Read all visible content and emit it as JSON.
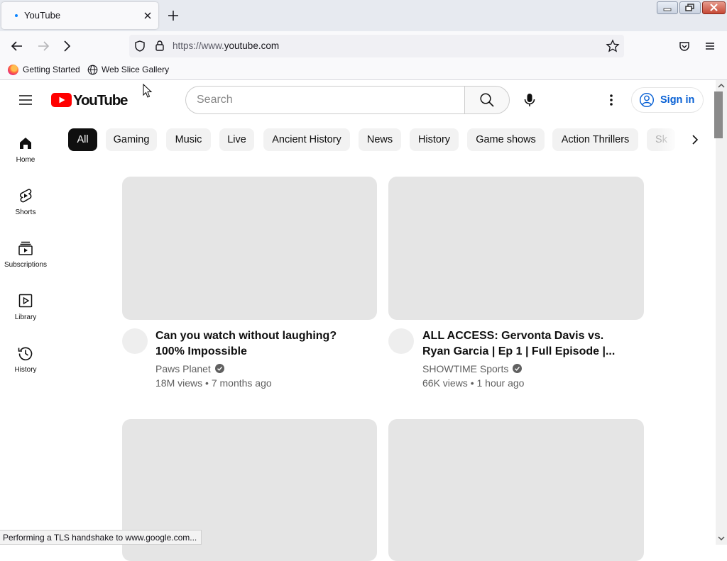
{
  "browser": {
    "tab_title": "YouTube",
    "url_prefix": "https://www.",
    "url_domain": "youtube.com",
    "bookmarks": [
      {
        "label": "Getting Started",
        "icon": "firefox-icon"
      },
      {
        "label": "Web Slice Gallery",
        "icon": "globe-icon"
      }
    ],
    "status_text": "Performing a TLS handshake to www.google.com..."
  },
  "youtube": {
    "logo_text": "YouTube",
    "search_placeholder": "Search",
    "sign_in_label": "Sign in",
    "chips": [
      "All",
      "Gaming",
      "Music",
      "Live",
      "Ancient History",
      "News",
      "History",
      "Game shows",
      "Action Thrillers",
      "Sk"
    ],
    "active_chip": "All",
    "guide": [
      {
        "label": "Home",
        "icon": "home-icon"
      },
      {
        "label": "Shorts",
        "icon": "shorts-icon"
      },
      {
        "label": "Subscriptions",
        "icon": "subscriptions-icon"
      },
      {
        "label": "Library",
        "icon": "library-icon"
      },
      {
        "label": "History",
        "icon": "history-icon"
      }
    ],
    "videos": [
      {
        "title": "Can you watch without laughing? 100% Impossible",
        "channel": "Paws Planet",
        "verified": true,
        "views": "18M views",
        "age": "7 months ago"
      },
      {
        "title": "ALL ACCESS: Gervonta Davis vs. Ryan Garcia | Ep 1 | Full Episode |...",
        "channel": "SHOWTIME Sports",
        "verified": true,
        "views": "66K views",
        "age": "1 hour ago"
      }
    ],
    "colors": {
      "brand_red": "#ff0000",
      "link_blue": "#065fd4",
      "thumb_placeholder": "#e5e5e5"
    }
  }
}
